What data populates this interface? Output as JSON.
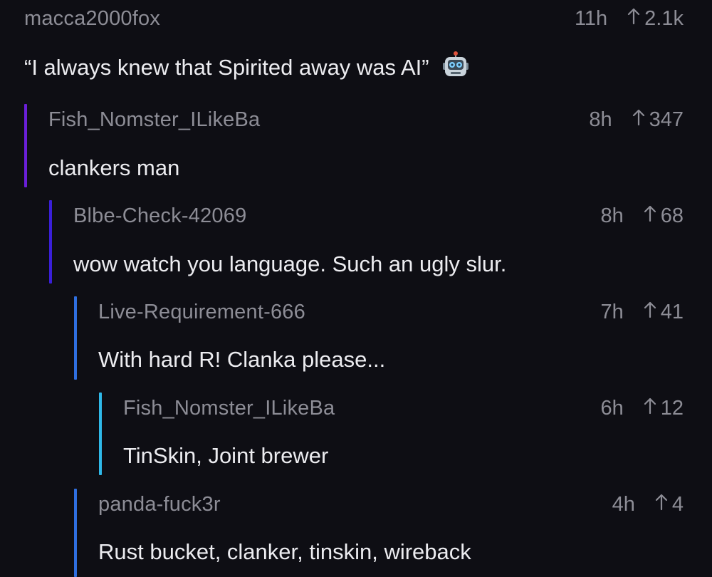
{
  "comments": [
    {
      "author": "macca2000fox",
      "age": "11h",
      "score": "2.1k",
      "text": "“I always knew that Spirited away was AI”",
      "emoji": "robot-face",
      "thread_color": null
    },
    {
      "author": "Fish_Nomster_ILikeBa",
      "age": "8h",
      "score": "347",
      "text": "clankers man",
      "thread_color": "#6a1fd8"
    },
    {
      "author": "Blbe-Check-42069",
      "age": "8h",
      "score": "68",
      "text": "wow watch you language. Such an ugly slur.",
      "thread_color": "#3a1fd8"
    },
    {
      "author": "Live-Requirement-666",
      "age": "7h",
      "score": "41",
      "text": "With hard R! Clanka please...",
      "thread_color": "#2f6fe0"
    },
    {
      "author": "Fish_Nomster_ILikeBa",
      "age": "6h",
      "score": "12",
      "text": "TinSkin, Joint brewer",
      "thread_color": "#2fb8e8"
    },
    {
      "author": "panda-fuck3r",
      "age": "4h",
      "score": "4",
      "text": "Rust bucket, clanker, tinskin, wireback",
      "thread_color": "#2f6fe0"
    }
  ],
  "icons": {
    "upvote": "arrow-up-icon",
    "emoji": "robot-face-icon"
  }
}
